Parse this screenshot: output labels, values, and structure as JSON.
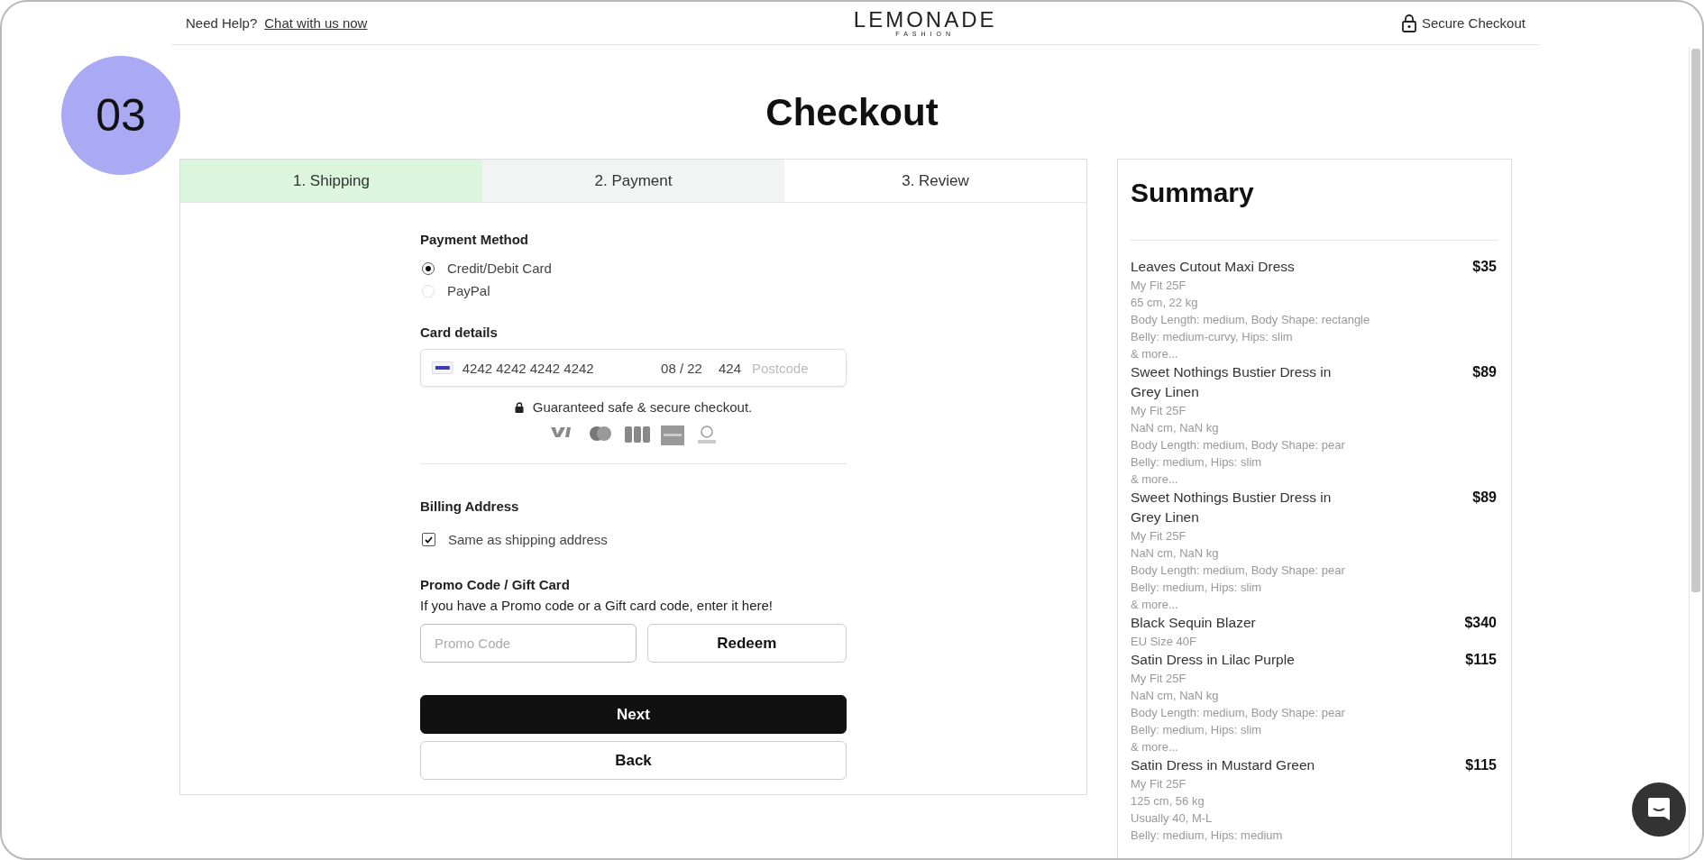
{
  "header": {
    "help_label": "Need Help?",
    "help_link": "Chat with us now",
    "logo": "LEMONADE",
    "logo_sub": "FASHION",
    "secure": "Secure Checkout"
  },
  "step_badge": "03",
  "title": "Checkout",
  "tabs": [
    {
      "label": "1. Shipping",
      "completed": true,
      "selected": false
    },
    {
      "label": "2. Payment",
      "completed": false,
      "selected": true
    },
    {
      "label": "3. Review",
      "completed": false,
      "selected": false
    }
  ],
  "payment": {
    "heading": "Payment Method",
    "options": [
      {
        "label": "Credit/Debit Card",
        "selected": true
      },
      {
        "label": "PayPal",
        "selected": false
      }
    ]
  },
  "card": {
    "heading": "Card details",
    "number": "4242 4242 4242 4242",
    "expiry": "08 / 22",
    "cvc": "424",
    "postcode_placeholder": "Postcode",
    "guarantee": "Guaranteed safe & secure checkout."
  },
  "billing": {
    "heading": "Billing Address",
    "same_label": "Same as shipping address",
    "checked": true
  },
  "promo": {
    "heading": "Promo Code / Gift Card",
    "description": "If you have a Promo code or a Gift card code, enter it here!",
    "placeholder": "Promo Code",
    "redeem": "Redeem"
  },
  "buttons": {
    "next": "Next",
    "back": "Back"
  },
  "summary": {
    "title": "Summary",
    "items": [
      {
        "name": "Leaves Cutout Maxi Dress",
        "price": "$35",
        "details": [
          "My Fit 25F",
          "65 cm, 22 kg",
          "Body Length: medium, Body Shape: rectangle",
          "Belly: medium-curvy, Hips: slim",
          "& more..."
        ]
      },
      {
        "name": "Sweet Nothings Bustier Dress in Grey Linen",
        "price": "$89",
        "details": [
          "My Fit 25F",
          "NaN cm, NaN kg",
          "Body Length: medium, Body Shape: pear",
          "Belly: medium, Hips: slim",
          "& more..."
        ]
      },
      {
        "name": "Sweet Nothings Bustier Dress in Grey Linen",
        "price": "$89",
        "details": [
          "My Fit 25F",
          "NaN cm, NaN kg",
          "Body Length: medium, Body Shape: pear",
          "Belly: medium, Hips: slim",
          "& more..."
        ]
      },
      {
        "name": "Black Sequin Blazer",
        "price": "$340",
        "details": [
          "EU Size 40F"
        ]
      },
      {
        "name": "Satin Dress in Lilac Purple",
        "price": "$115",
        "details": [
          "My Fit 25F",
          "NaN cm, NaN kg",
          "Body Length: medium, Body Shape: pear",
          "Belly: medium, Hips: slim",
          "& more..."
        ]
      },
      {
        "name": "Satin Dress in Mustard Green",
        "price": "$115",
        "details": [
          "My Fit 25F",
          "125 cm, 56 kg",
          "Usually 40, M-L",
          "Belly: medium, Hips: medium"
        ]
      }
    ]
  }
}
